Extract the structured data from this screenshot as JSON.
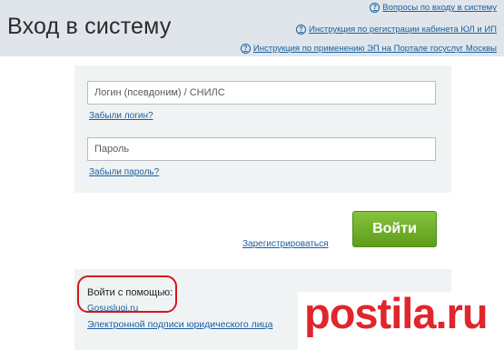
{
  "header": {
    "title": "Вход в систему",
    "links": [
      "Вопросы по входу в систему",
      "Инструкция по регистрации кабинета ЮЛ и ИП",
      "Инструкция по применению ЭП на Портале госуслуг Москвы"
    ]
  },
  "form": {
    "login_placeholder": "Логин (псевдоним) / СНИЛС",
    "forgot_login": "Забыли логин?",
    "password_placeholder": "Пароль",
    "forgot_password": "Забыли пароль?",
    "submit_label": "Войти",
    "register_label": "Зарегистрироваться"
  },
  "alt_login": {
    "title": "Войти с помощью:",
    "gosuslugi": "Gosuslugi.ru",
    "signature": "Электронной подписи юридического лица"
  },
  "watermark": "postila.ru",
  "colors": {
    "header_bg": "#dfe5ea",
    "link": "#1a5f9e",
    "button": "#6fae2a",
    "highlight": "#d4171e"
  }
}
